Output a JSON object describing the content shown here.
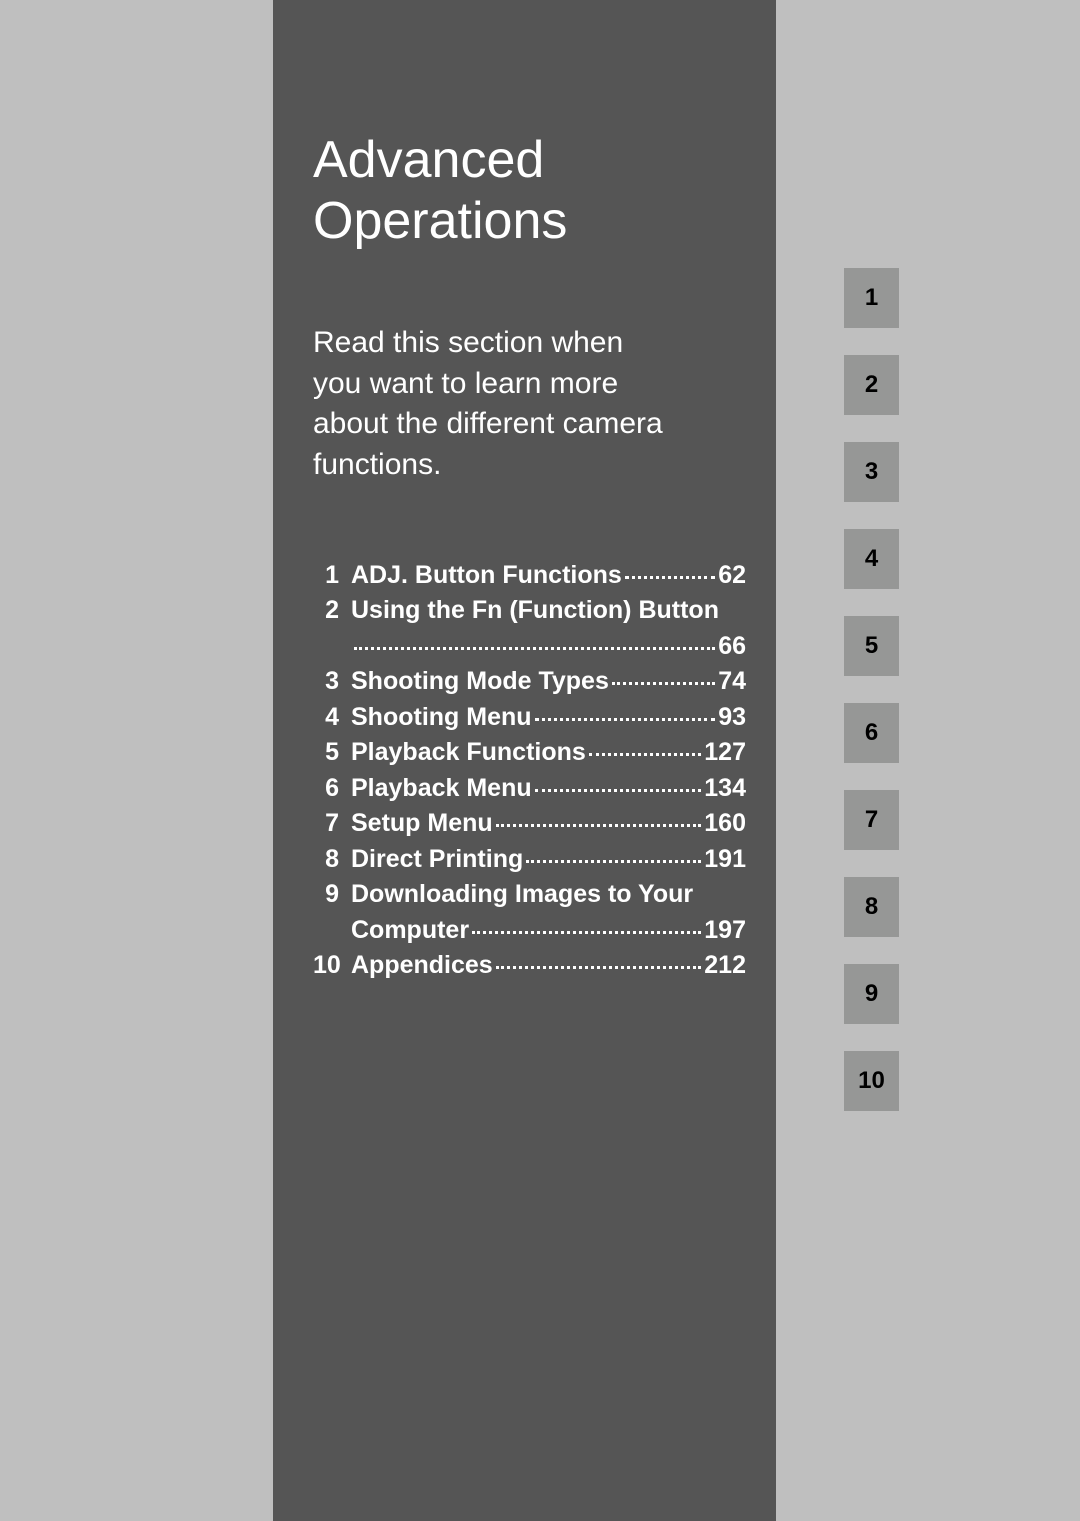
{
  "title_line1": "Advanced",
  "title_line2": "Operations",
  "intro": "Read this section when you want to learn more about the different camera functions.",
  "toc": [
    {
      "num": "1",
      "label": "ADJ. Button Functions",
      "page": "62",
      "wrap": false
    },
    {
      "num": "2",
      "label": "Using the Fn (Function) Button",
      "page": "66",
      "wrap": true
    },
    {
      "num": "3",
      "label": "Shooting Mode Types",
      "page": "74",
      "wrap": false
    },
    {
      "num": "4",
      "label": "Shooting Menu",
      "page": "93",
      "wrap": false
    },
    {
      "num": "5",
      "label": "Playback Functions",
      "page": "127",
      "wrap": false
    },
    {
      "num": "6",
      "label": "Playback Menu",
      "page": "134",
      "wrap": false
    },
    {
      "num": "7",
      "label": "Setup Menu",
      "page": "160",
      "wrap": false
    },
    {
      "num": "8",
      "label": "Direct Printing",
      "page": "191",
      "wrap": false
    },
    {
      "num": "9",
      "label": "Downloading Images to Your",
      "label2": "Computer",
      "page": "197",
      "wrap": true
    },
    {
      "num": "10",
      "label": "Appendices",
      "page": "212",
      "wrap": false
    }
  ],
  "tabs": [
    "1",
    "2",
    "3",
    "4",
    "5",
    "6",
    "7",
    "8",
    "9",
    "10"
  ]
}
